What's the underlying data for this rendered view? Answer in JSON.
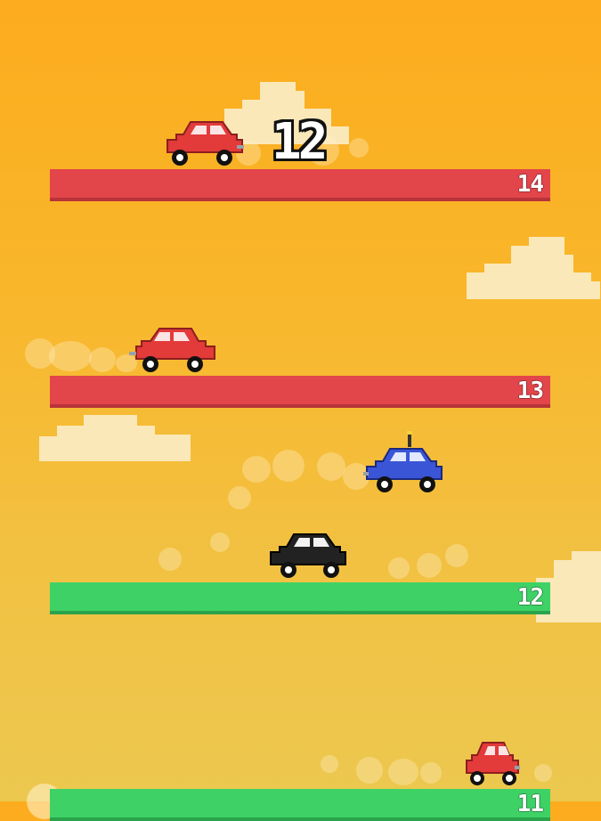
{
  "hud": {
    "score": "12"
  },
  "platforms": [
    {
      "level": "14",
      "color": "#e2454a"
    },
    {
      "level": "13",
      "color": "#e2454a"
    },
    {
      "level": "12",
      "color": "#3ed266"
    },
    {
      "level": "11",
      "color": "#3ed266"
    }
  ],
  "cars": [
    {
      "name": "red-car",
      "color": "#e33a3a"
    },
    {
      "name": "red-car",
      "color": "#e33a3a"
    },
    {
      "name": "blue-player-car",
      "color": "#3a55d6"
    },
    {
      "name": "black-car",
      "color": "#222222"
    },
    {
      "name": "red-car",
      "color": "#e33a3a"
    }
  ],
  "colors": {
    "sky_top": "#fcac1e",
    "sky_bottom": "#ecc84f",
    "cloud": "#fbe8b8"
  }
}
